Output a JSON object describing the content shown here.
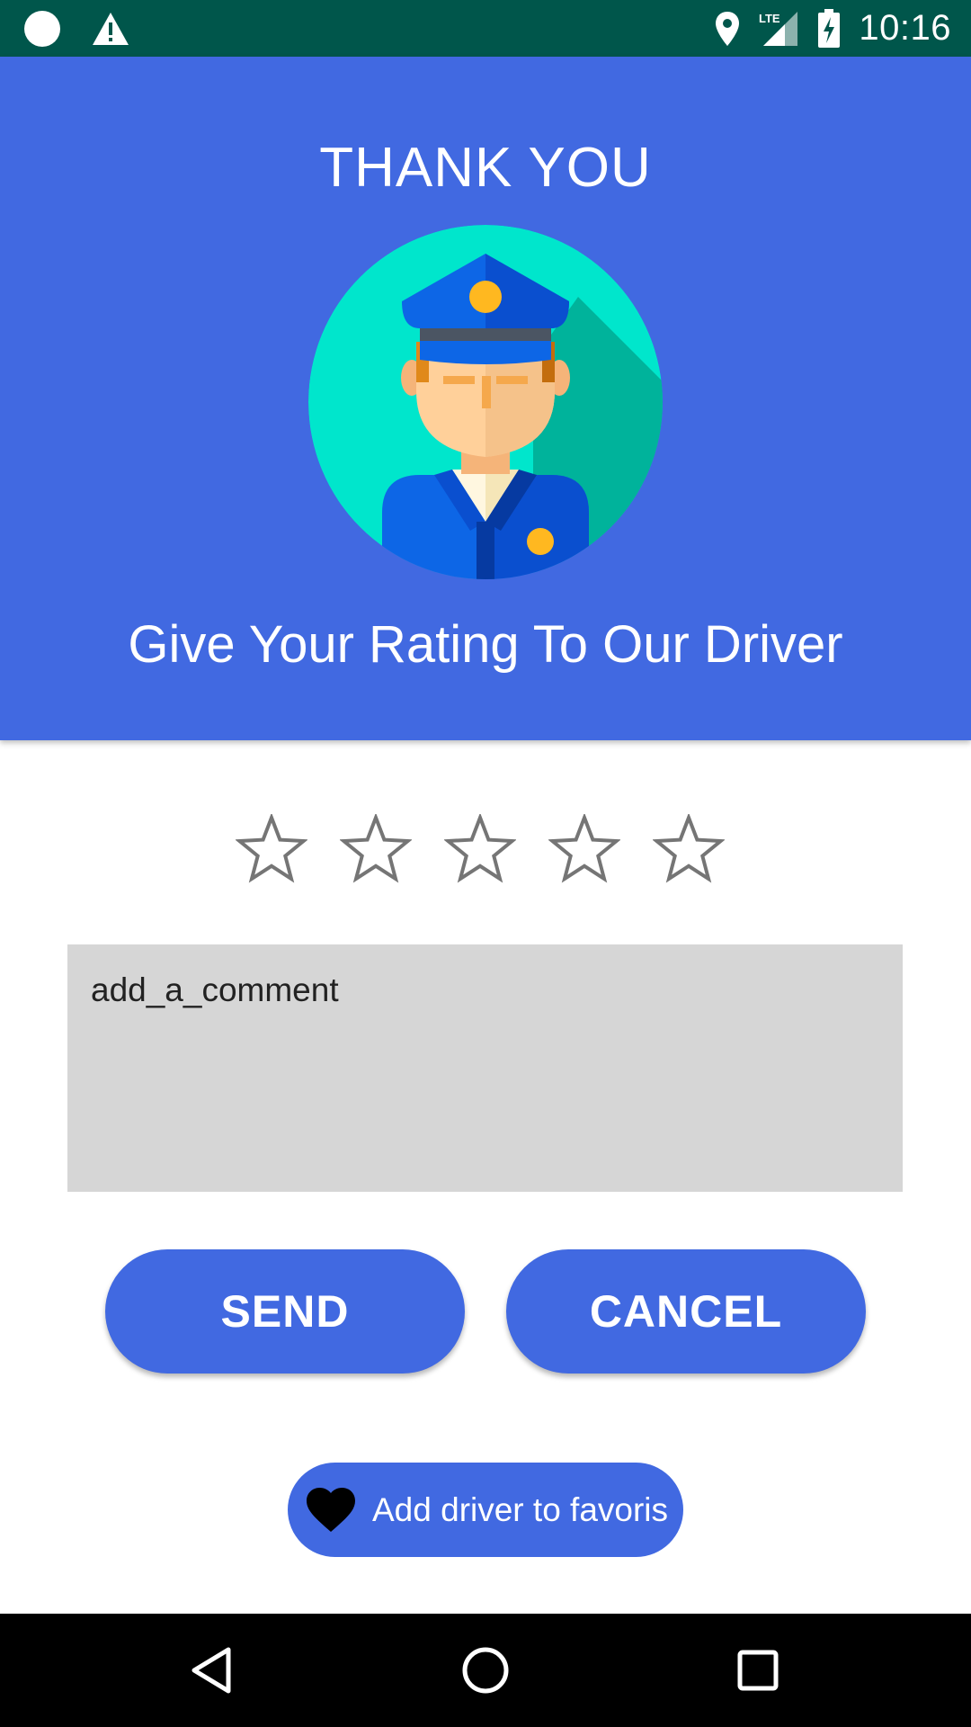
{
  "status_bar": {
    "time": "10:16",
    "icons": [
      "circle-notification-icon",
      "warning-icon",
      "location-icon",
      "lte-signal-icon",
      "battery-charging-icon"
    ],
    "network_label": "LTE"
  },
  "header": {
    "title": "THANK YOU",
    "subtitle": "Give Your Rating To Our Driver",
    "avatar_icon": "driver-avatar-icon"
  },
  "rating": {
    "max": 5,
    "value": 0
  },
  "comment": {
    "placeholder": "add_a_comment",
    "value": ""
  },
  "actions": {
    "send_label": "SEND",
    "cancel_label": "CANCEL"
  },
  "favorite": {
    "label": "Add driver to favoris",
    "icon": "heart-icon"
  },
  "nav_bar": {
    "icons": [
      "back-icon",
      "home-icon",
      "recents-icon"
    ]
  },
  "colors": {
    "primary": "#4169e1",
    "status_bar": "#00564b",
    "comment_bg": "#d6d6d6",
    "star_outline": "#757575"
  }
}
